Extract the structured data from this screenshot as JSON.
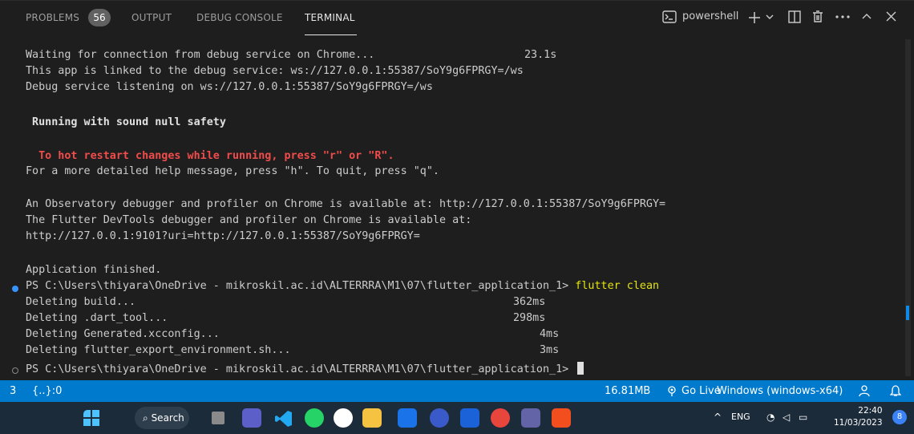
{
  "panel_tabs": [
    {
      "label": "PROBLEMS",
      "badge": "56"
    },
    {
      "label": "OUTPUT"
    },
    {
      "label": "DEBUG CONSOLE"
    },
    {
      "label": "TERMINAL",
      "active": true
    }
  ],
  "terminal_toolbar": {
    "shell_label": "powershell",
    "icons": [
      "terminal-icon",
      "plus-icon",
      "chevron-down-icon",
      "split-icon",
      "trash-icon",
      "ellipsis-icon",
      "chevron-up-icon",
      "close-icon"
    ]
  },
  "terminal_lines": [
    {
      "text": "Waiting for connection from debug service on Chrome...",
      "time": "23.1s"
    },
    {
      "text": "This app is linked to the debug service: ws://127.0.0.1:55387/SoY9g6FPRGY=/ws"
    },
    {
      "text": "Debug service listening on ws://127.0.0.1:55387/SoY9g6FPRGY=/ws"
    },
    {
      "text": " Running with sound null safety"
    },
    {
      "text": "  To hot restart changes while running, press \"r\" or \"R\"."
    },
    {
      "text": "For a more detailed help message, press \"h\". To quit, press \"q\"."
    },
    {
      "text": "An Observatory debugger and profiler on Chrome is available at: http://127.0.0.1:55387/SoY9g6FPRGY="
    },
    {
      "text": "The Flutter DevTools debugger and profiler on Chrome is available at:"
    },
    {
      "text": "http://127.0.0.1:9101?uri=http://127.0.0.1:55387/SoY9g6FPRGY="
    },
    {
      "text": "Application finished."
    },
    {
      "prompt": "PS C:\\Users\\thiyara\\OneDrive - mikroskil.ac.id\\ALTERRRA\\M1\\07\\flutter_application_1> ",
      "command": "flutter clean"
    },
    {
      "text": "Deleting build...",
      "time": "362ms"
    },
    {
      "text": "Deleting .dart_tool...",
      "time": "298ms"
    },
    {
      "text": "Deleting Generated.xcconfig...",
      "time": "4ms"
    },
    {
      "text": "Deleting flutter_export_environment.sh...",
      "time": "3ms"
    },
    {
      "prompt": "PS C:\\Users\\thiyara\\OneDrive - mikroskil.ac.id\\ALTERRRA\\M1\\07\\flutter_application_1> "
    }
  ],
  "status_bar": {
    "left": [
      "3",
      "{..}:0"
    ],
    "memory": "16.81MB",
    "go_live": "Go Live",
    "platform": "Windows (windows-x64)"
  },
  "taskbar": {
    "search_label": "Search",
    "apps": [
      "windows-start-icon",
      "search-icon",
      "task-view-icon",
      "teams-chat-icon",
      "vscode-icon",
      "whatsapp-icon",
      "github-icon",
      "file-explorer-icon",
      "mail-icon",
      "app-icon",
      "dropbox-icon",
      "chrome-icon",
      "teams-icon",
      "figma-icon"
    ],
    "lang": "ENG",
    "time": "22:40",
    "date": "11/03/2023",
    "notifications": "8"
  },
  "colors": {
    "bg": "#1e1e1e",
    "status": "#007acc",
    "taskbar": "#1c2b3a",
    "error_text": "#f14c4c",
    "command": "#e5e510",
    "prompt_dot": "#3794ff"
  }
}
